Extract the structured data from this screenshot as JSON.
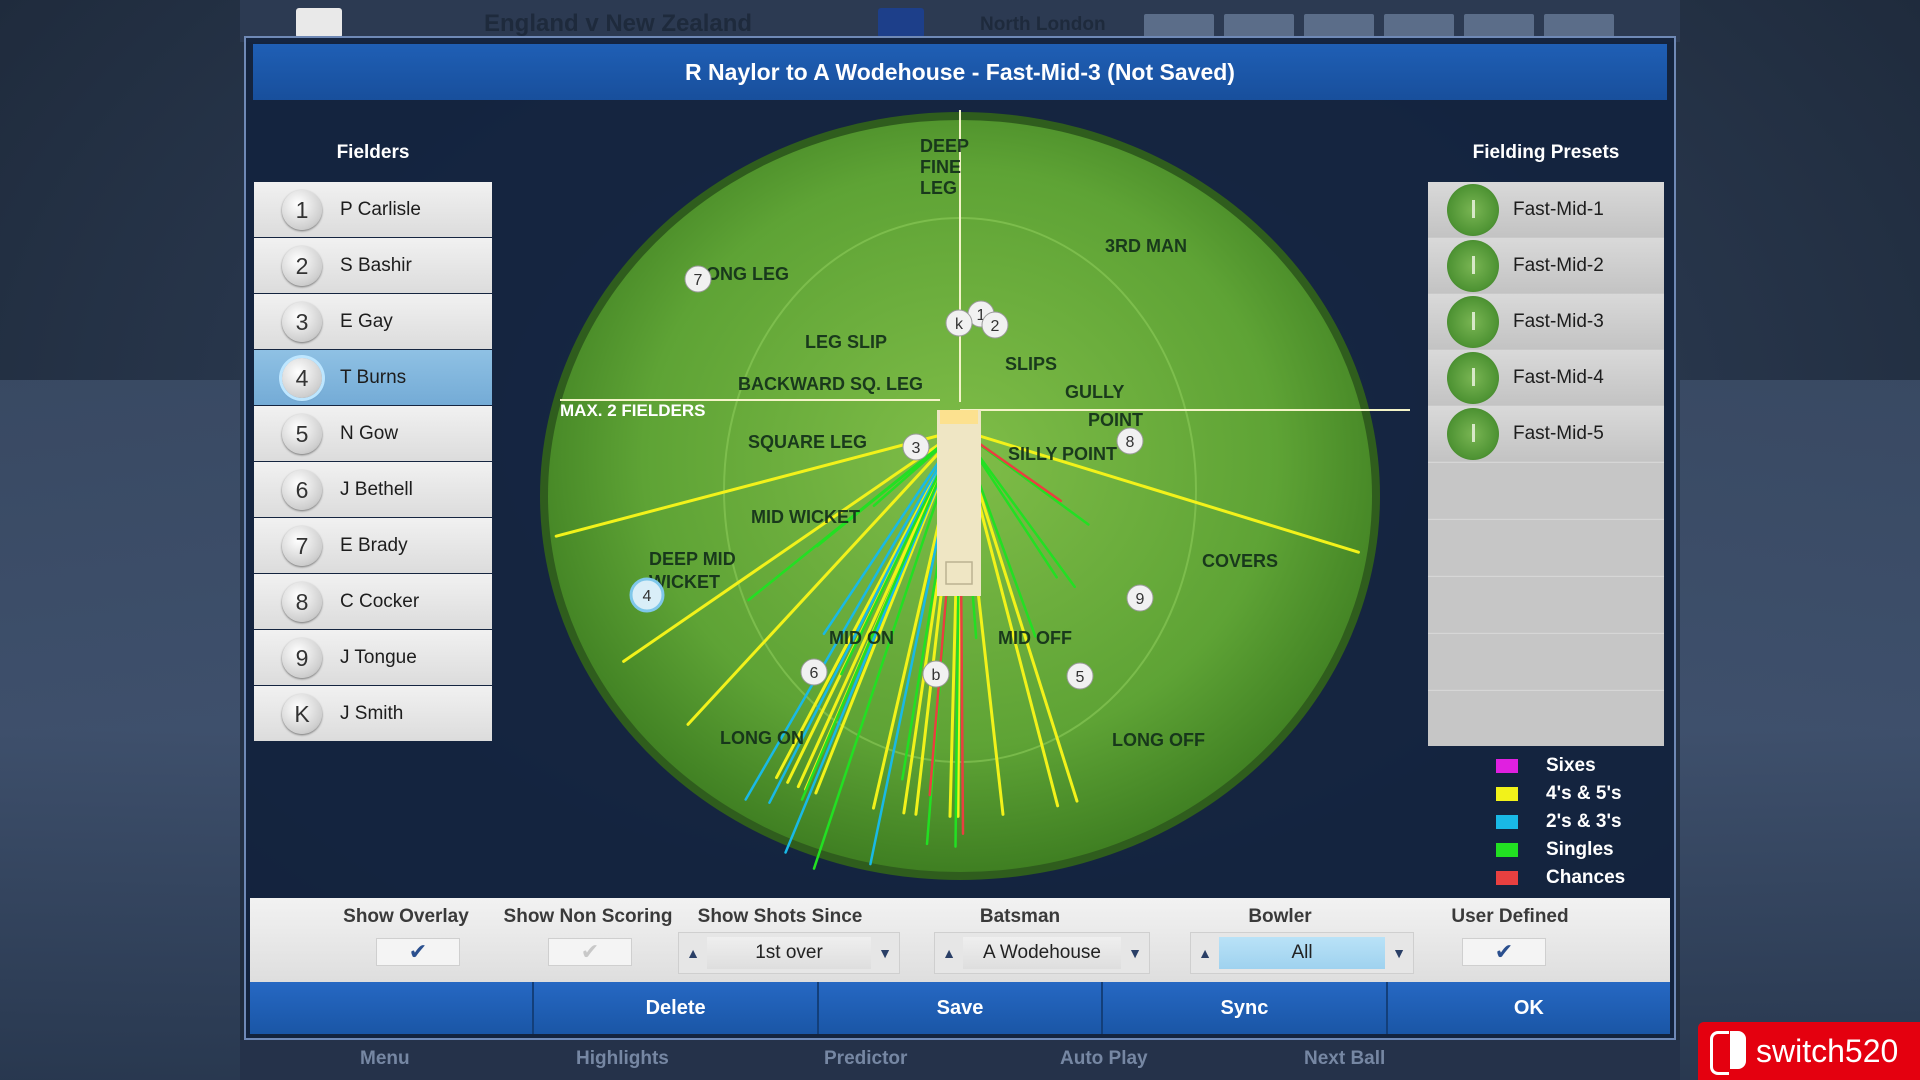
{
  "background": {
    "match_title": "England v New Zealand",
    "venue": "North London",
    "nav": [
      "Menu",
      "Highlights",
      "Predictor",
      "Auto Play",
      "Next Ball"
    ]
  },
  "dialog": {
    "title": "R Naylor to A Wodehouse - Fast-Mid-3 (Not Saved)"
  },
  "fielders": {
    "heading": "Fielders",
    "selected_index": 3,
    "items": [
      {
        "num": "1",
        "name": "P Carlisle"
      },
      {
        "num": "2",
        "name": "S Bashir"
      },
      {
        "num": "3",
        "name": "E Gay"
      },
      {
        "num": "4",
        "name": "T Burns"
      },
      {
        "num": "5",
        "name": "N Gow"
      },
      {
        "num": "6",
        "name": "J Bethell"
      },
      {
        "num": "7",
        "name": "E Brady"
      },
      {
        "num": "8",
        "name": "C Cocker"
      },
      {
        "num": "9",
        "name": "J Tongue"
      },
      {
        "num": "K",
        "name": "J Smith"
      }
    ]
  },
  "field": {
    "zones": [
      "DEEP",
      "FINE",
      "LEG",
      "3RD MAN",
      "LONG LEG",
      "LEG SLIP",
      "SLIPS",
      "BACKWARD SQ. LEG",
      "GULLY",
      "POINT",
      "SQUARE LEG",
      "SILLY POINT",
      "MID WICKET",
      "DEEP MID",
      "WICKET",
      "COVERS",
      "MID ON",
      "MID OFF",
      "LONG ON",
      "LONG OFF"
    ],
    "max_fielders_label": "MAX. 2 FIELDERS",
    "markers": [
      "1",
      "2",
      "3",
      "4",
      "5",
      "6",
      "7",
      "8",
      "9",
      "k",
      "b"
    ]
  },
  "presets": {
    "heading": "Fielding Presets",
    "items": [
      "Fast-Mid-1",
      "Fast-Mid-2",
      "Fast-Mid-3",
      "Fast-Mid-4",
      "Fast-Mid-5"
    ]
  },
  "legend": [
    {
      "label": "Sixes",
      "color": "#e020e0"
    },
    {
      "label": "4's & 5's",
      "color": "#f2f21a"
    },
    {
      "label": "2's & 3's",
      "color": "#19b9e6"
    },
    {
      "label": "Singles",
      "color": "#22e022"
    },
    {
      "label": "Chances",
      "color": "#e84040"
    }
  ],
  "controls": {
    "show_overlay": {
      "label": "Show Overlay",
      "checked": true
    },
    "show_non_scoring": {
      "label": "Show Non Scoring",
      "checked": false
    },
    "show_shots_since": {
      "label": "Show Shots Since",
      "value": "1st over"
    },
    "batsman": {
      "label": "Batsman",
      "value": "A Wodehouse"
    },
    "bowler": {
      "label": "Bowler",
      "value": "All"
    },
    "user_defined": {
      "label": "User Defined",
      "checked": true
    }
  },
  "buttons": {
    "delete": "Delete",
    "save": "Save",
    "sync": "Sync",
    "ok": "OK"
  },
  "watermark": "switch520",
  "glyphs": {
    "check": "✔",
    "up": "▲",
    "down": "▼"
  }
}
